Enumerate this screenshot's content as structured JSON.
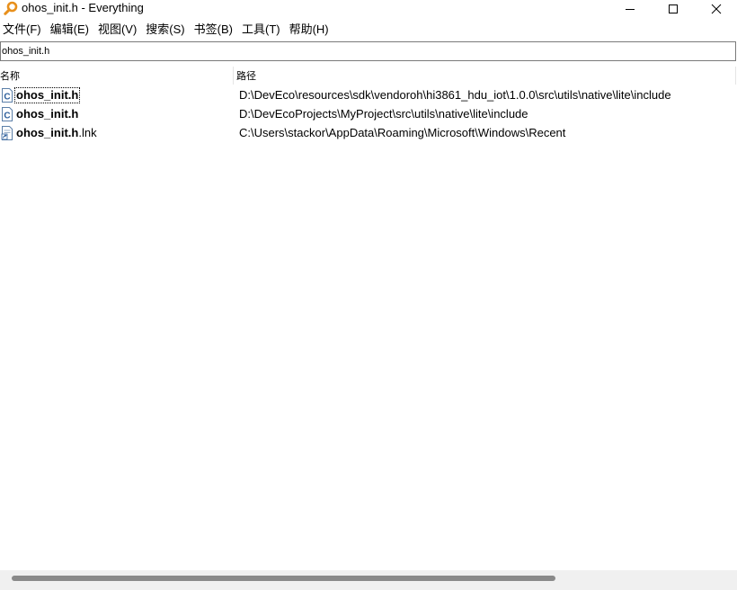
{
  "window": {
    "title": "ohos_init.h - Everything",
    "icon": "magnifier-icon",
    "accent": "#e8901c"
  },
  "menu": {
    "items": [
      {
        "label": "文件(F)"
      },
      {
        "label": "编辑(E)"
      },
      {
        "label": "视图(V)"
      },
      {
        "label": "搜索(S)"
      },
      {
        "label": "书签(B)"
      },
      {
        "label": "工具(T)"
      },
      {
        "label": "帮助(H)"
      }
    ]
  },
  "search": {
    "value": "ohos_init.h"
  },
  "columns": {
    "name": "名称",
    "path": "路径"
  },
  "results": [
    {
      "name_bold": "ohos_init.h",
      "name_rest": "",
      "icon": "c-header-file-icon",
      "path": "D:\\DevEco\\resources\\sdk\\vendoroh\\hi3861_hdu_iot\\1.0.0\\src\\utils\\native\\lite\\include"
    },
    {
      "name_bold": "ohos_init.h",
      "name_rest": "",
      "icon": "c-header-file-icon",
      "path": "D:\\DevEcoProjects\\MyProject\\src\\utils\\native\\lite\\include"
    },
    {
      "name_bold": "ohos_init.h",
      "name_rest": ".lnk",
      "icon": "shortcut-file-icon",
      "path": "C:\\Users\\stackor\\AppData\\Roaming\\Microsoft\\Windows\\Recent"
    }
  ]
}
